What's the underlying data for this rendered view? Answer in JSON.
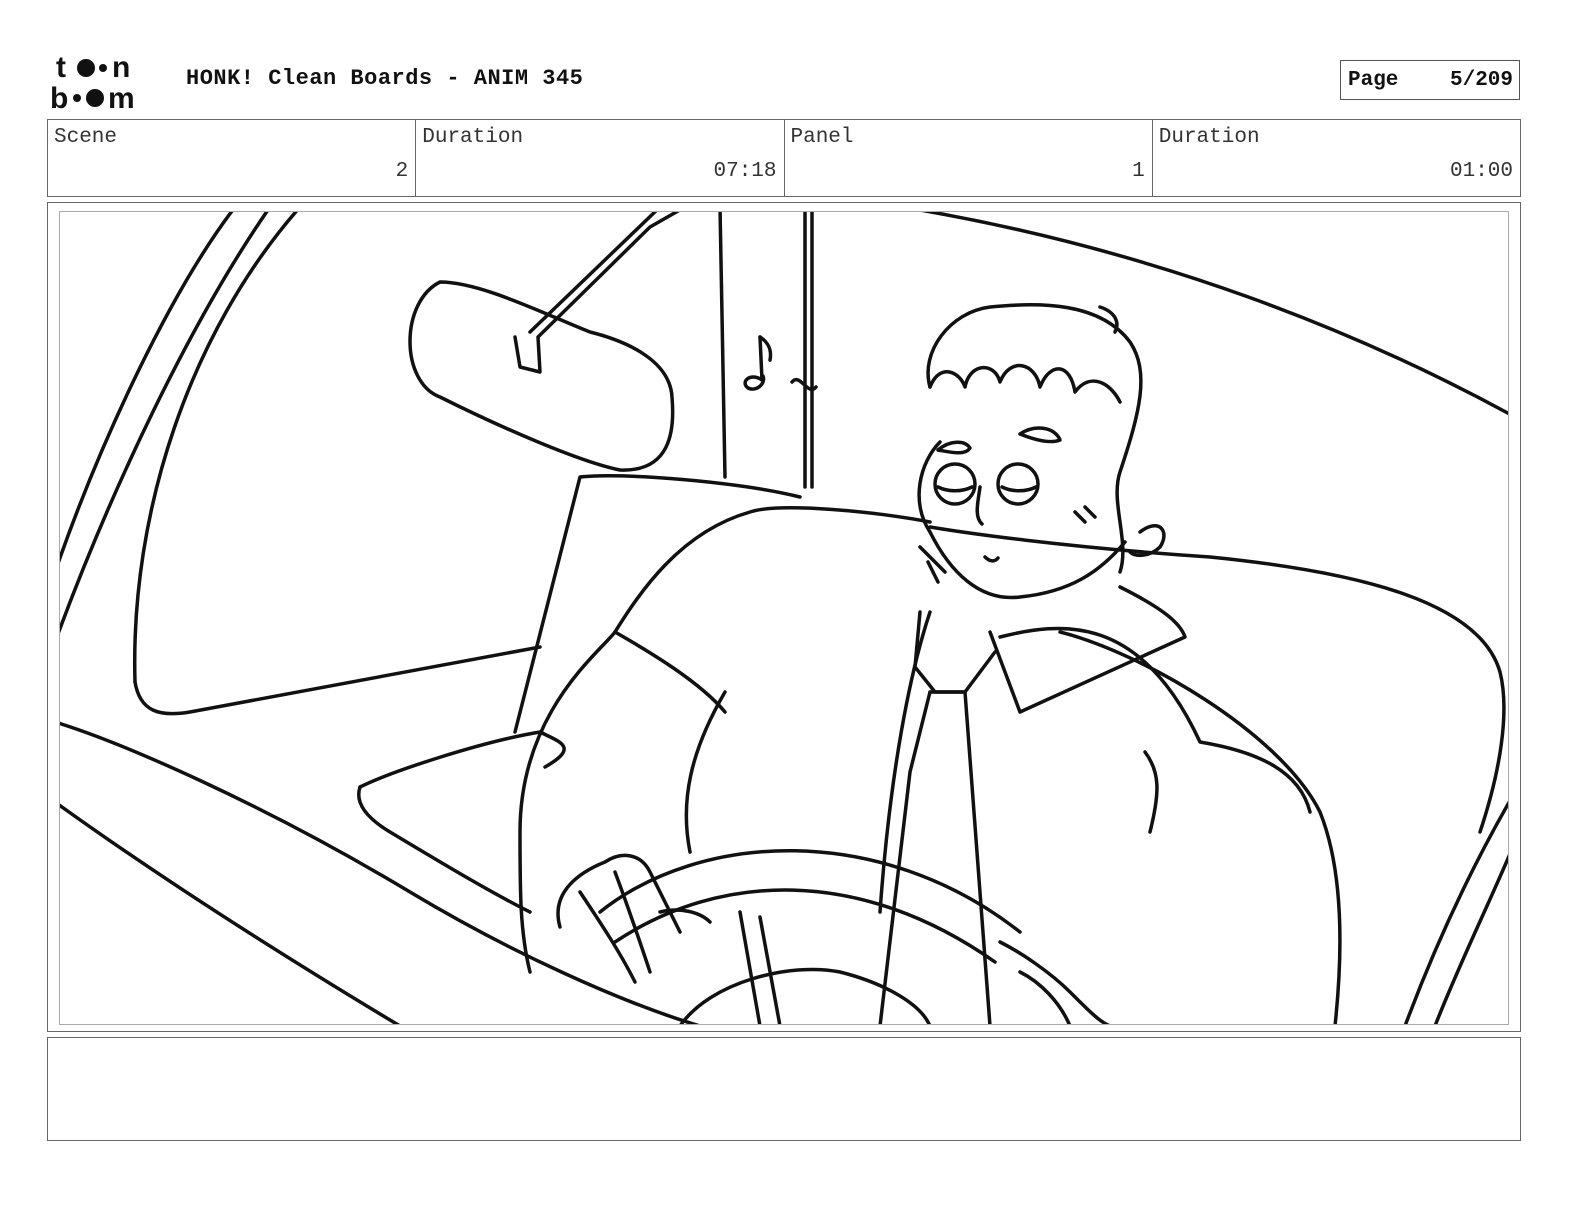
{
  "header": {
    "logo_text": "toon boom",
    "title": "HONK! Clean Boards - ANIM 345",
    "page_label": "Page",
    "page_value": "5/209"
  },
  "info": {
    "scene_label": "Scene",
    "scene_value": "2",
    "scene_duration_label": "Duration",
    "scene_duration_value": "07:18",
    "panel_label": "Panel",
    "panel_value": "1",
    "panel_duration_label": "Duration",
    "panel_duration_value": "01:00"
  },
  "notes": {
    "text": ""
  }
}
